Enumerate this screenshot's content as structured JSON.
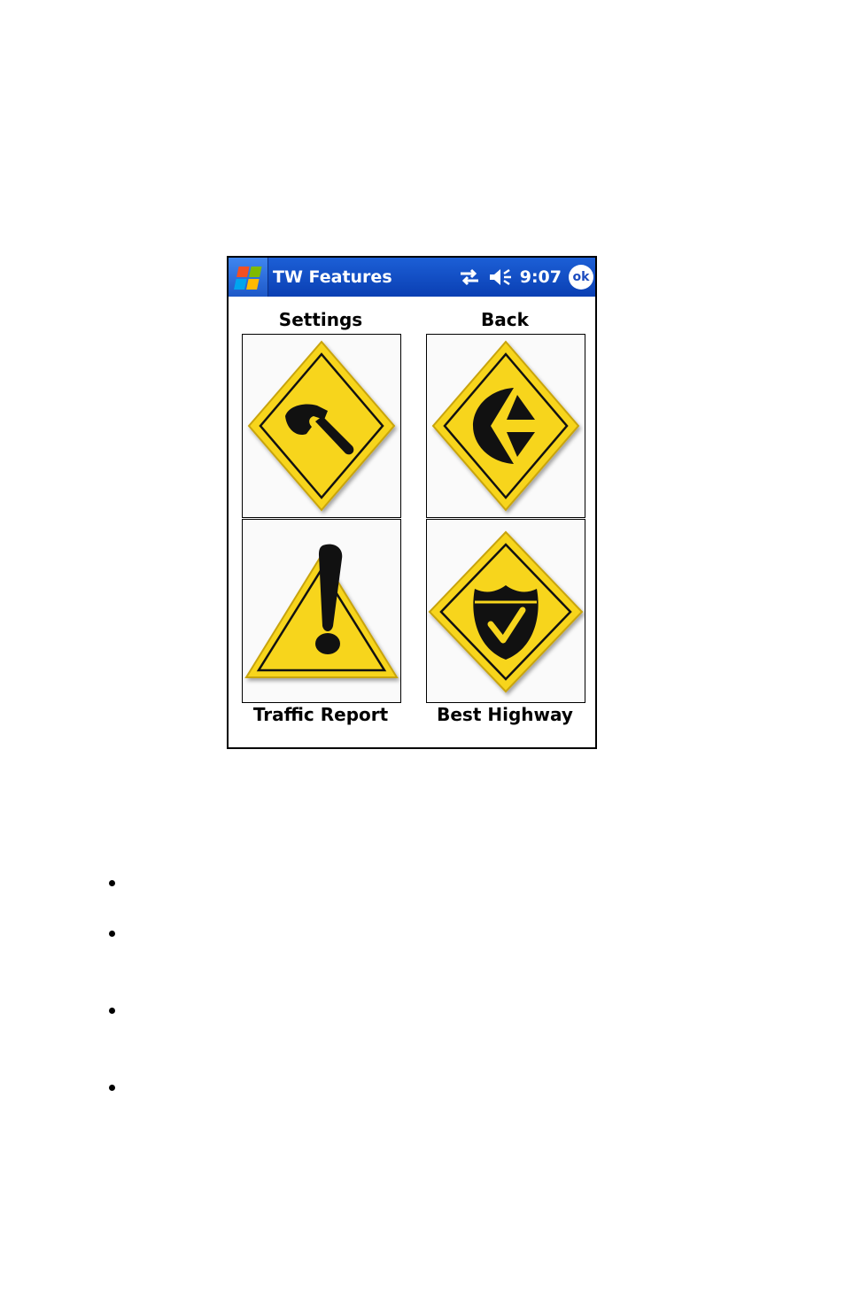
{
  "window": {
    "title": "TW  Features",
    "clock": "9:07",
    "ok_label": "ok"
  },
  "tiles": [
    {
      "label": "Settings",
      "icon": "hammer-icon"
    },
    {
      "label": "Back",
      "icon": "back-arrow-icon"
    },
    {
      "label": "Traffic Report",
      "icon": "warning-exclamation-icon"
    },
    {
      "label": "Best Highway",
      "icon": "highway-shield-check-icon"
    }
  ],
  "colors": {
    "titlebar": "#1c5fd6",
    "sign_yellow": "#f7d51d",
    "sign_black": "#111111"
  }
}
